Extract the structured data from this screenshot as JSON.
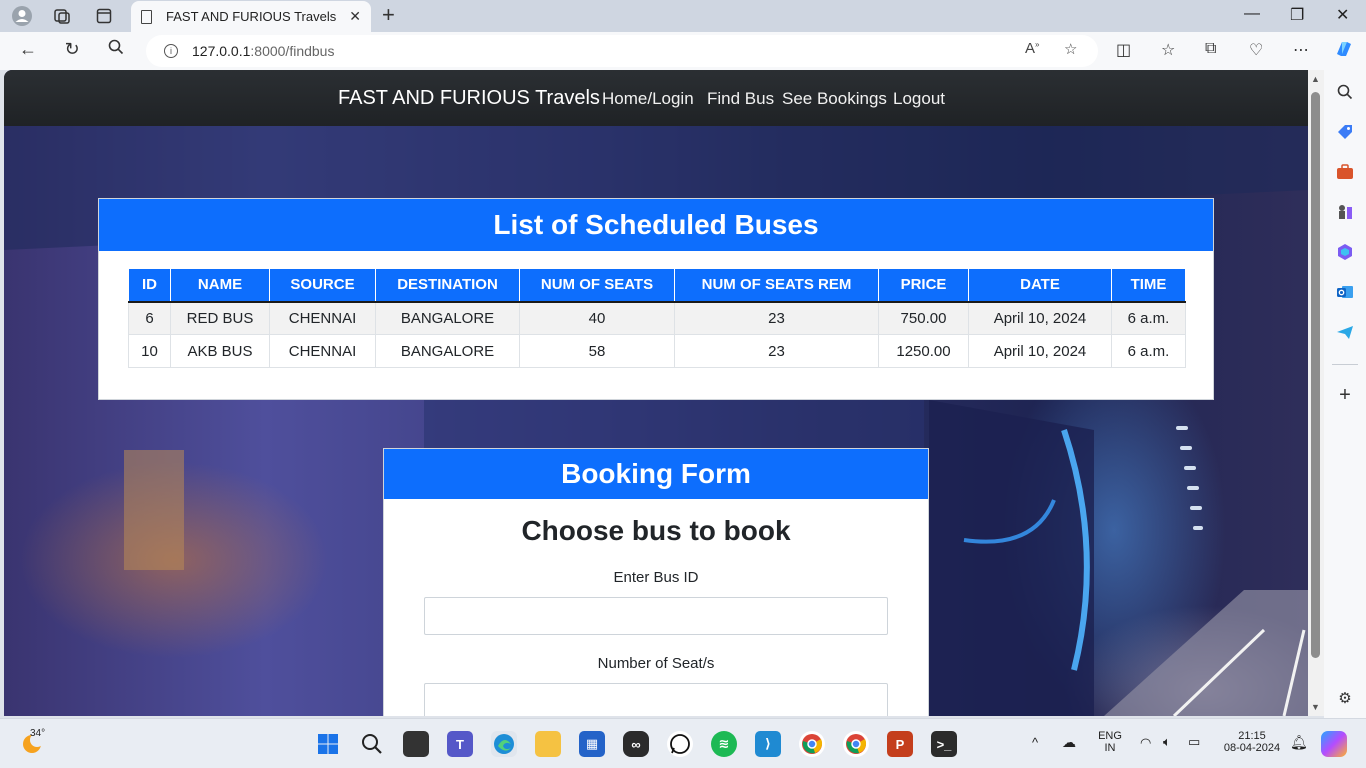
{
  "browser": {
    "tab_title": "FAST AND FURIOUS Travels",
    "url_host": "127.0.0.1",
    "url_rest": ":8000/findbus"
  },
  "site": {
    "brand": "FAST AND FURIOUS Travels",
    "nav": [
      "Home/Login",
      "Find Bus",
      "See Bookings",
      "Logout"
    ]
  },
  "buses": {
    "heading": "List of Scheduled Buses",
    "columns": [
      "ID",
      "NAME",
      "SOURCE",
      "DESTINATION",
      "NUM OF SEATS",
      "NUM OF SEATS REM",
      "PRICE",
      "DATE",
      "TIME"
    ],
    "rows": [
      [
        "6",
        "RED BUS",
        "CHENNAI",
        "BANGALORE",
        "40",
        "23",
        "750.00",
        "April 10, 2024",
        "6 a.m."
      ],
      [
        "10",
        "AKB BUS",
        "CHENNAI",
        "BANGALORE",
        "58",
        "23",
        "1250.00",
        "April 10, 2024",
        "6 a.m."
      ]
    ]
  },
  "booking_form": {
    "heading": "Booking Form",
    "title": "Choose bus to book",
    "bus_id_label": "Enter Bus ID",
    "bus_id_value": "",
    "seats_label": "Number of Seat/s",
    "seats_value": ""
  },
  "taskbar": {
    "weather": "34°",
    "lang_1": "ENG",
    "lang_2": "IN",
    "time": "21:15",
    "date": "08-04-2024"
  },
  "colors": {
    "accent": "#0d6efd",
    "navbar": "#212529"
  }
}
